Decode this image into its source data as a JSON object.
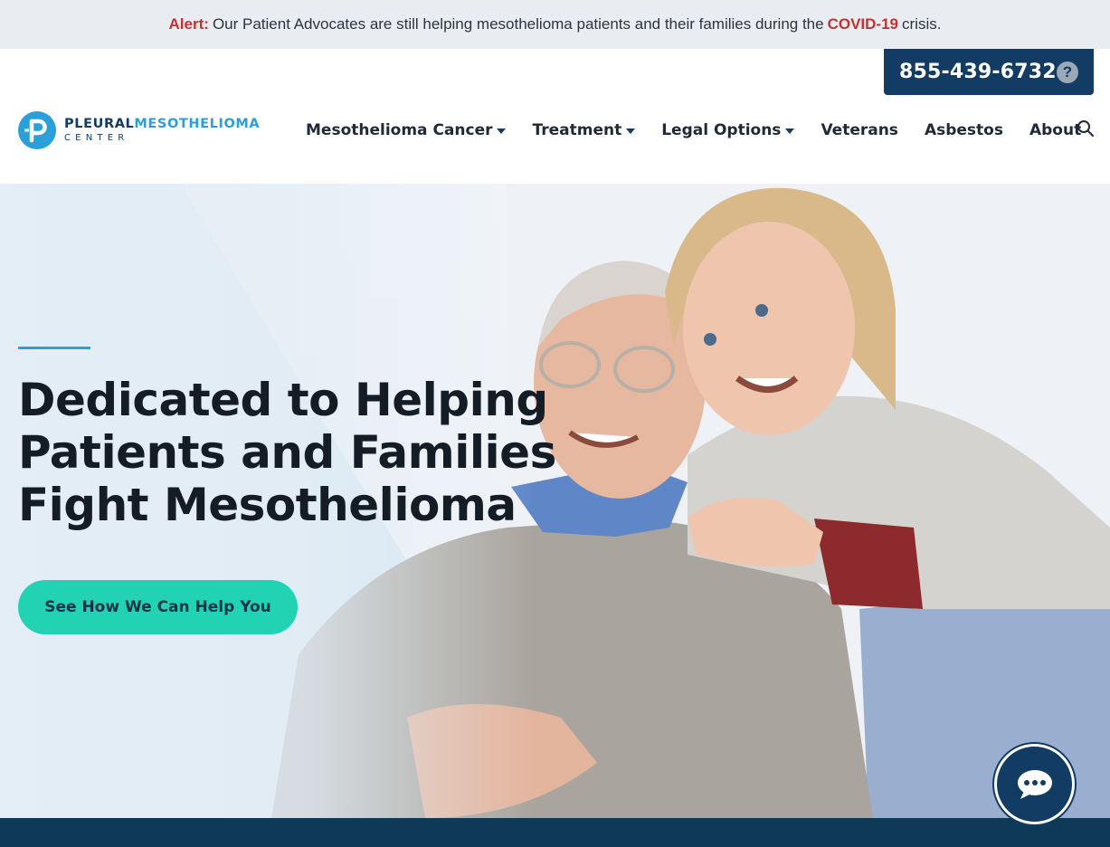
{
  "alert": {
    "label": "Alert:",
    "text_before": "Our Patient Advocates are still helping mesothelioma patients and their families during the",
    "highlight": "COVID-19",
    "text_after": "crisis."
  },
  "header": {
    "phone": "855-439-6732",
    "help_icon": "question-circle-icon",
    "logo": {
      "word1": "PLEURAL",
      "word2": "MESOTHELIOMA",
      "word3": "CENTER"
    },
    "nav": [
      {
        "label": "Mesothelioma Cancer",
        "dropdown": true
      },
      {
        "label": "Treatment",
        "dropdown": true
      },
      {
        "label": "Legal Options",
        "dropdown": true
      },
      {
        "label": "Veterans",
        "dropdown": false
      },
      {
        "label": "Asbestos",
        "dropdown": false
      },
      {
        "label": "About",
        "dropdown": false
      }
    ],
    "search_icon": "search-icon"
  },
  "hero": {
    "title_line1": "Dedicated to Helping",
    "title_line2": "Patients and Families",
    "title_line3": "Fight Mesothelioma",
    "cta": "See How We Can Help You"
  },
  "chat": {
    "icon": "chat-bubble-icon"
  },
  "colors": {
    "navy": "#123c63",
    "brand_blue": "#2a9fd8",
    "alert_red": "#c8302f",
    "cta_teal": "#22d3b3",
    "footer": "#0f3a57"
  }
}
